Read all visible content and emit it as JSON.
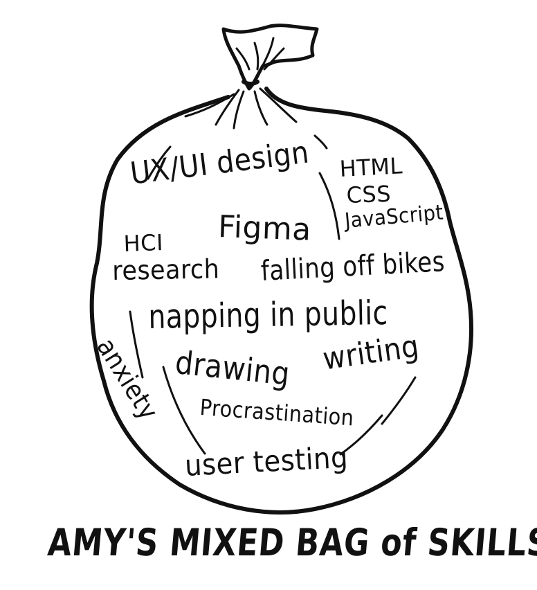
{
  "title": "AMY'S MIXED BAG of SKILLS",
  "skills": {
    "ux_ui_design": "UX/UI design",
    "html": "HTML",
    "css": "CSS",
    "javascript": "JavaScript",
    "figma": "Figma",
    "hci": "HCI",
    "research": "research",
    "falling_off_bikes": "falling off bikes",
    "napping_in_public": "napping in public",
    "drawing": "drawing",
    "writing": "writing",
    "anxiety": "anxiety",
    "procrastination": "Procrastination",
    "user_testing": "user testing"
  },
  "colors": {
    "ink": "#111111",
    "background": "#ffffff"
  }
}
